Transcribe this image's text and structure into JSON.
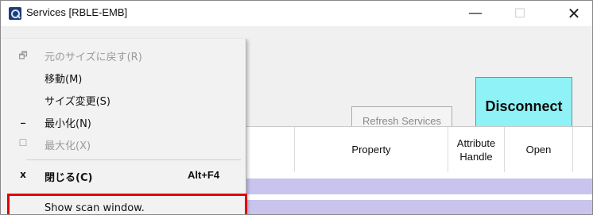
{
  "window": {
    "title": "Services [RBLE-EMB]",
    "icon": "app-search-icon",
    "controls": {
      "minimize": "—",
      "maximize": "☐",
      "close": "✕"
    }
  },
  "toolbar": {
    "refresh_label": "Refresh Services",
    "disconnect_label": "Disconnect"
  },
  "table": {
    "columns": [
      "",
      "Property",
      "Attribute\nHandle",
      "Open",
      ""
    ],
    "row_color": "#c8c4ee"
  },
  "system_menu": {
    "items": [
      {
        "glyph": "🗗",
        "label": "元のサイズに戻す(R)",
        "accel": "",
        "disabled": true
      },
      {
        "glyph": "",
        "label": "移動(M)",
        "accel": "",
        "disabled": false
      },
      {
        "glyph": "",
        "label": "サイズ変更(S)",
        "accel": "",
        "disabled": false
      },
      {
        "glyph": "_",
        "label": "最小化(N)",
        "accel": "",
        "disabled": false
      },
      {
        "glyph": "☐",
        "label": "最大化(X)",
        "accel": "",
        "disabled": true
      },
      {
        "glyph": "x",
        "label": "閉じる(C)",
        "accel": "Alt+F4",
        "disabled": false,
        "bold": true
      },
      {
        "glyph": "",
        "label": "Show scan window.",
        "accel": "",
        "disabled": false
      }
    ]
  },
  "colors": {
    "disconnect_bg": "#8ff2f6",
    "highlight_border": "#e00000",
    "row_bg": "#c8c4ee"
  }
}
